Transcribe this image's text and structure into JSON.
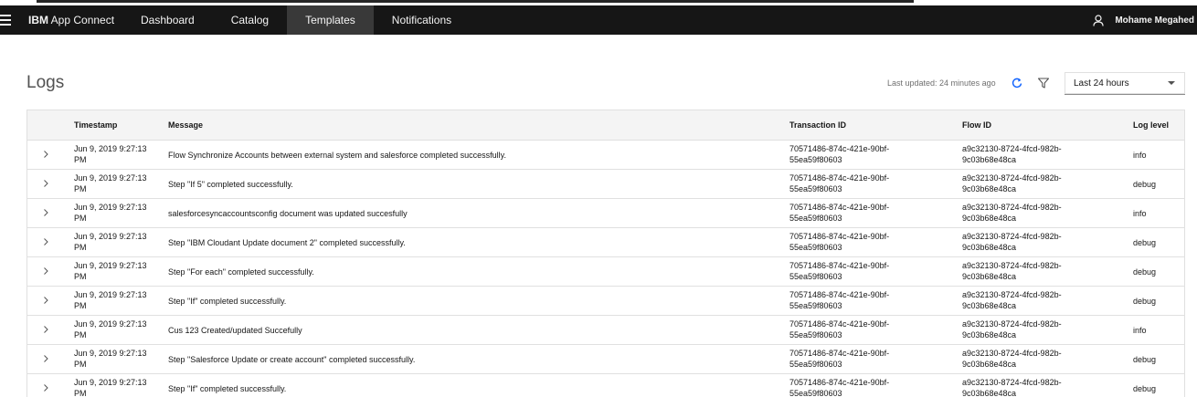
{
  "header": {
    "brand_bold": "IBM",
    "brand_rest": " App Connect",
    "nav": [
      {
        "label": "Dashboard",
        "active": false
      },
      {
        "label": "Catalog",
        "active": false
      },
      {
        "label": "Templates",
        "active": true
      },
      {
        "label": "Notifications",
        "active": false
      }
    ],
    "user_name": "Mohame Megahed",
    "icons": {
      "menu": "hamburger-menu-icon",
      "user": "user-icon"
    }
  },
  "page": {
    "title": "Logs",
    "last_updated": "Last updated: 24 minutes ago",
    "time_range": "Last 24 hours",
    "icons": {
      "refresh": "refresh-icon",
      "filter": "filter-icon",
      "dropdown": "chevron-down-icon"
    }
  },
  "table": {
    "columns": [
      "Timestamp",
      "Message",
      "Transaction ID",
      "Flow ID",
      "Log level"
    ],
    "rows": [
      {
        "ts1": "Jun 9, 2019 9:27:13",
        "ts2": "PM",
        "message": "Flow Synchronize Accounts between external system and salesforce completed successfully.",
        "tx1": "70571486-874c-421e-90bf-",
        "tx2": "55ea59f80603",
        "fl1": "a9c32130-8724-4fcd-982b-",
        "fl2": "9c03b68e48ca",
        "level": "info"
      },
      {
        "ts1": "Jun 9, 2019 9:27:13",
        "ts2": "PM",
        "message": "Step \"If 5\" completed successfully.",
        "tx1": "70571486-874c-421e-90bf-",
        "tx2": "55ea59f80603",
        "fl1": "a9c32130-8724-4fcd-982b-",
        "fl2": "9c03b68e48ca",
        "level": "debug"
      },
      {
        "ts1": "Jun 9, 2019 9:27:13",
        "ts2": "PM",
        "message": "salesforcesyncaccountsconfig document was updated succesfully",
        "tx1": "70571486-874c-421e-90bf-",
        "tx2": "55ea59f80603",
        "fl1": "a9c32130-8724-4fcd-982b-",
        "fl2": "9c03b68e48ca",
        "level": "info"
      },
      {
        "ts1": "Jun 9, 2019 9:27:13",
        "ts2": "PM",
        "message": "Step \"IBM Cloudant Update document 2\" completed successfully.",
        "tx1": "70571486-874c-421e-90bf-",
        "tx2": "55ea59f80603",
        "fl1": "a9c32130-8724-4fcd-982b-",
        "fl2": "9c03b68e48ca",
        "level": "debug"
      },
      {
        "ts1": "Jun 9, 2019 9:27:13",
        "ts2": "PM",
        "message": "Step \"For each\" completed successfully.",
        "tx1": "70571486-874c-421e-90bf-",
        "tx2": "55ea59f80603",
        "fl1": "a9c32130-8724-4fcd-982b-",
        "fl2": "9c03b68e48ca",
        "level": "debug"
      },
      {
        "ts1": "Jun 9, 2019 9:27:13",
        "ts2": "PM",
        "message": "Step \"If\" completed successfully.",
        "tx1": "70571486-874c-421e-90bf-",
        "tx2": "55ea59f80603",
        "fl1": "a9c32130-8724-4fcd-982b-",
        "fl2": "9c03b68e48ca",
        "level": "debug"
      },
      {
        "ts1": "Jun 9, 2019 9:27:13",
        "ts2": "PM",
        "message": "Cus 123 Created/updated Succefully",
        "tx1": "70571486-874c-421e-90bf-",
        "tx2": "55ea59f80603",
        "fl1": "a9c32130-8724-4fcd-982b-",
        "fl2": "9c03b68e48ca",
        "level": "info"
      },
      {
        "ts1": "Jun 9, 2019 9:27:13",
        "ts2": "PM",
        "message": "Step \"Salesforce Update or create account\" completed successfully.",
        "tx1": "70571486-874c-421e-90bf-",
        "tx2": "55ea59f80603",
        "fl1": "a9c32130-8724-4fcd-982b-",
        "fl2": "9c03b68e48ca",
        "level": "debug"
      },
      {
        "ts1": "Jun 9, 2019 9:27:13",
        "ts2": "PM",
        "message": "Step \"If\" completed successfully.",
        "tx1": "70571486-874c-421e-90bf-",
        "tx2": "55ea59f80603",
        "fl1": "a9c32130-8724-4fcd-982b-",
        "fl2": "9c03b68e48ca",
        "level": "debug"
      }
    ]
  },
  "colors": {
    "topbar": "#161616",
    "active_tab": "#393939",
    "text_light": "#f4f4f4",
    "header_bg": "#f4f4f4",
    "border": "#e0e0e0"
  }
}
